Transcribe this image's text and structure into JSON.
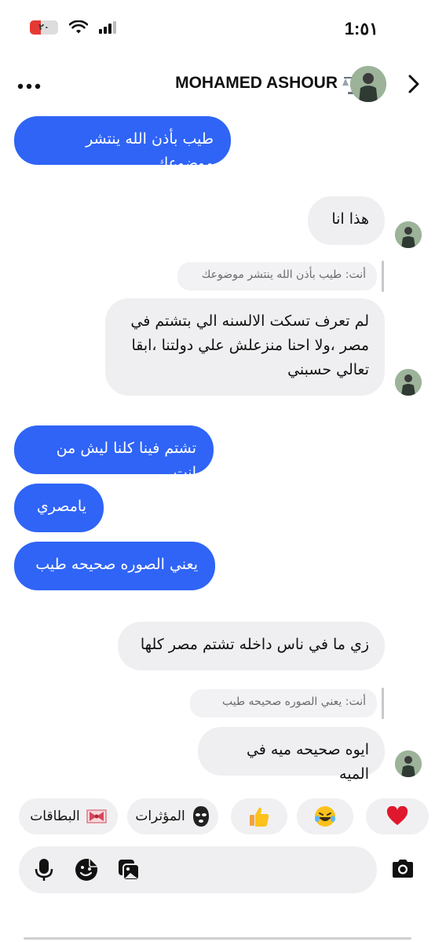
{
  "status_bar": {
    "time": "1:٥١",
    "battery_level": "٢٠",
    "battery_color": "#e53935"
  },
  "header": {
    "contact_name": "MOHAMED ASHOUR",
    "name_emoji_icon": "balance-scale-icon",
    "more_icon": "more-horizontal-icon",
    "back_icon": "chevron-right-icon"
  },
  "messages": [
    {
      "sender": "me",
      "text": "طيب بأذن الله ينتشر موضوعك"
    },
    {
      "sender": "contact",
      "text": "هذا انا"
    },
    {
      "sender": "contact",
      "reply_to": "أنت: طيب بأذن الله ينتشر موضوعك",
      "text": "لم تعرف تسكت الالسنه الي بتشتم في مصر ،ولا احنا منزعلش علي دولتنا ،ابقا تعالي حسبني"
    },
    {
      "sender": "me",
      "text": "تشتم فينا كلنا ليش من انت"
    },
    {
      "sender": "me",
      "text": "يامصري"
    },
    {
      "sender": "me",
      "text": "يعني الصوره صحيحه طيب"
    },
    {
      "sender": "contact",
      "text": "زي ما في ناس داخله تشتم مصر كلها"
    },
    {
      "sender": "contact",
      "reply_to": "أنت: يعني الصوره صحيحه طيب",
      "text": "ايوه صحيحه ميه في الميه"
    }
  ],
  "quick_reactions": [
    {
      "icon": "heart-icon",
      "label": ""
    },
    {
      "icon": "laughing-tears-icon",
      "label": ""
    },
    {
      "icon": "thumbs-up-icon",
      "label": ""
    },
    {
      "icon": "ski-mask-icon",
      "label": "المؤثرات"
    },
    {
      "icon": "ribbon-bow-icon",
      "label": "البطاقات"
    }
  ],
  "composer": {
    "placeholder": "",
    "icons": [
      "microphone-icon",
      "sticker-icon",
      "gallery-icon",
      "camera-icon"
    ]
  },
  "colors": {
    "outgoing_bubble": "#2f64f6",
    "incoming_bubble": "#efeff1",
    "heart": "#e0182d"
  }
}
